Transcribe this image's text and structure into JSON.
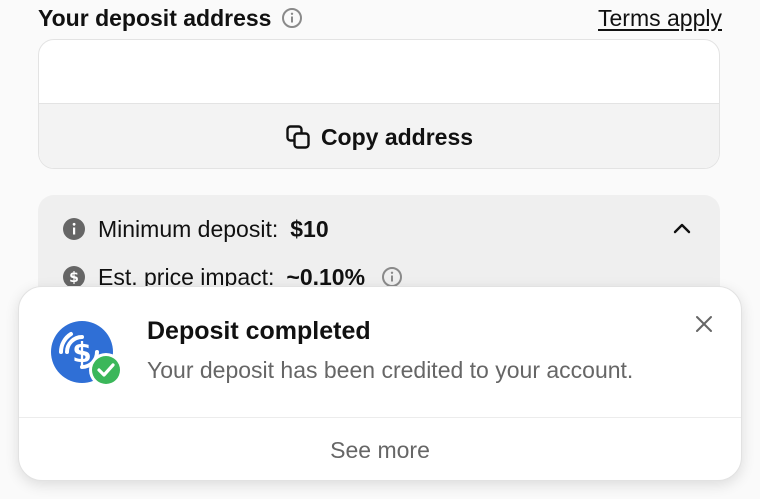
{
  "header": {
    "title": "Your deposit address",
    "terms_label": "Terms apply"
  },
  "address_card": {
    "address_value": "",
    "copy_label": "Copy address"
  },
  "info": {
    "min_deposit_label": "Minimum deposit:",
    "min_deposit_value": "$10",
    "price_impact_label": "Est. price impact:",
    "price_impact_value": "~0.10%"
  },
  "toast": {
    "title": "Deposit completed",
    "message": "Your deposit has been credited to your account.",
    "see_more_label": "See more",
    "coin_color": "#2f6fd6",
    "check_color": "#3bb75a"
  },
  "icons": [
    "info-icon",
    "copy-icon",
    "chevron-up-icon",
    "dollar-circle-icon",
    "usdc-coin-icon",
    "check-badge-icon",
    "close-icon"
  ]
}
